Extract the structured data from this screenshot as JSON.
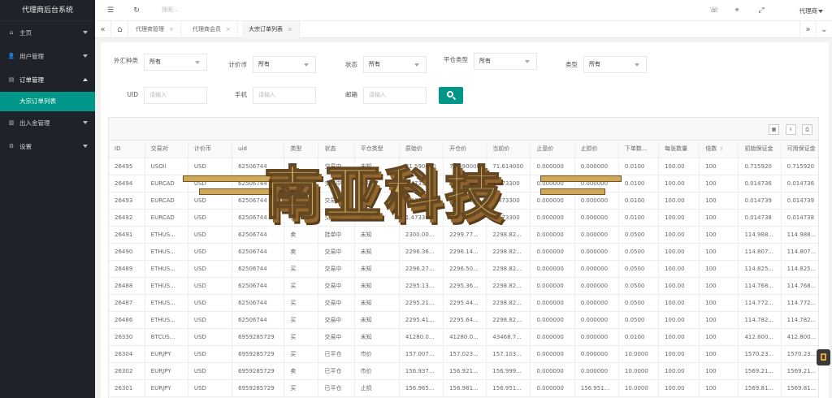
{
  "app": {
    "title": "代理商后台系统"
  },
  "sidebar": {
    "items": [
      {
        "label": "主页",
        "icon": "home-icon",
        "open": false
      },
      {
        "label": "用户管理",
        "icon": "user-icon",
        "open": false
      },
      {
        "label": "订单管理",
        "icon": "order-icon",
        "open": true
      },
      {
        "label": "出入金管理",
        "icon": "money-icon",
        "open": false
      },
      {
        "label": "设置",
        "icon": "gear-icon",
        "open": false
      }
    ],
    "sub_items": [
      {
        "label": "大宗订单列表",
        "active": true
      }
    ]
  },
  "header": {
    "search_placeholder": "搜索...",
    "user": "代理商"
  },
  "tabs": [
    {
      "label": "代理商管理",
      "active": false
    },
    {
      "label": "代理商会员",
      "active": false
    },
    {
      "label": "大宗订单列表",
      "active": true
    }
  ],
  "filters": {
    "forex_type": {
      "label": "外汇种类",
      "value": "所有"
    },
    "currency": {
      "label": "计价币",
      "value": "所有"
    },
    "status": {
      "label": "状态",
      "value": "所有"
    },
    "close_type": {
      "label": "平仓类型",
      "value": "所有"
    },
    "type": {
      "label": "类型",
      "value": "所有"
    },
    "uid": {
      "label": "UID",
      "placeholder": "请输入"
    },
    "phone": {
      "label": "手机",
      "placeholder": "请输入"
    },
    "email": {
      "label": "邮箱",
      "placeholder": "请输入"
    }
  },
  "table": {
    "columns": [
      "ID",
      "交易对",
      "计价币",
      "uid",
      "类型",
      "状态",
      "平仓类型",
      "原始价",
      "开仓价",
      "当前价",
      "止盈价",
      "止损价",
      "下单数...",
      "每张数量",
      "倍数",
      "初始保证金",
      "可用保证金"
    ],
    "rows": [
      [
        "26495",
        "USOil",
        "USD",
        "62506744",
        "买",
        "交易中",
        "未知",
        "71.590000",
        "71.590000",
        "71.614000",
        "0.000000",
        "0.000000",
        "0.0100",
        "100.00",
        "100",
        "0.715920",
        "0.715920"
      ],
      [
        "26494",
        "EURCAD",
        "USD",
        "62506744",
        "买",
        "交易中",
        "未知",
        "1.473300",
        "1.473300",
        "1.473300",
        "0.000000",
        "0.000000",
        "0.0100",
        "100.00",
        "100",
        "0.014736",
        "0.014736"
      ],
      [
        "26493",
        "EURCAD",
        "USD",
        "62506744",
        "买",
        "交易中",
        "未知",
        "1.473740",
        "1.473300",
        "1.473300",
        "0.000000",
        "0.000000",
        "0.0100",
        "100.00",
        "100",
        "0.014739",
        "0.014739"
      ],
      [
        "26492",
        "EURCAD",
        "USD",
        "62506744",
        "买",
        "交易中",
        "未知",
        "1.473300",
        "1.473310",
        "1.473300",
        "0.000000",
        "0.000000",
        "0.0100",
        "100.00",
        "100",
        "0.014738",
        "0.014738"
      ],
      [
        "26491",
        "ETHUS...",
        "USD",
        "62506744",
        "卖",
        "挂单中",
        "未知",
        "2300.00...",
        "2299.77...",
        "2298.82...",
        "0.000000",
        "0.000000",
        "0.0500",
        "100.00",
        "100",
        "114.988...",
        "114.988..."
      ],
      [
        "26490",
        "ETHUS...",
        "USD",
        "62506744",
        "卖",
        "交易中",
        "未知",
        "2296.36...",
        "2296.14...",
        "2298.82...",
        "0.000000",
        "0.000000",
        "0.0500",
        "100.00",
        "100",
        "114.807...",
        "114.807..."
      ],
      [
        "26489",
        "ETHUS...",
        "USD",
        "62506744",
        "买",
        "交易中",
        "未知",
        "2296.27...",
        "2296.50...",
        "2298.82...",
        "0.000000",
        "0.000000",
        "0.0500",
        "100.00",
        "100",
        "114.825...",
        "114.825..."
      ],
      [
        "26488",
        "ETHUS...",
        "USD",
        "62506744",
        "买",
        "交易中",
        "未知",
        "2295.13...",
        "2295.36...",
        "2298.82...",
        "0.000000",
        "0.000000",
        "0.0500",
        "100.00",
        "100",
        "114.768...",
        "114.768..."
      ],
      [
        "26487",
        "ETHUS...",
        "USD",
        "62506744",
        "买",
        "交易中",
        "未知",
        "2295.21...",
        "2295.44...",
        "2298.82...",
        "0.000000",
        "0.000000",
        "0.0500",
        "100.00",
        "100",
        "114.772...",
        "114.772..."
      ],
      [
        "26486",
        "ETHUS...",
        "USD",
        "62506744",
        "买",
        "交易中",
        "未知",
        "2295.41...",
        "2295.64...",
        "2298.82...",
        "0.000000",
        "0.000000",
        "0.0500",
        "100.00",
        "100",
        "114.782...",
        "114.782..."
      ],
      [
        "26330",
        "BTCUS...",
        "USD",
        "6959285729",
        "买",
        "交易中",
        "未知",
        "41280.0...",
        "41280.0...",
        "43468.7...",
        "0.000000",
        "0.000000",
        "0.0100",
        "100.00",
        "100",
        "412.800...",
        "412.800..."
      ],
      [
        "26304",
        "EURJPY",
        "USD",
        "6959285729",
        "买",
        "已平仓",
        "市价",
        "157.007...",
        "157.023...",
        "157.103...",
        "0.000000",
        "0.000000",
        "10.0000",
        "100.00",
        "100",
        "1570.23...",
        "1570.23..."
      ],
      [
        "26302",
        "EURJPY",
        "USD",
        "6959285729",
        "卖",
        "已平仓",
        "市价",
        "156.937...",
        "156.921...",
        "156.999...",
        "0.000000",
        "0.000000",
        "10.0000",
        "100.00",
        "100",
        "1569.21...",
        "1569.21..."
      ],
      [
        "26301",
        "EURJPY",
        "USD",
        "6959285729",
        "买",
        "已平仓",
        "止损",
        "156.965...",
        "156.981...",
        "156.951...",
        "0.000000",
        "156.951...",
        "10.0000",
        "100.00",
        "100",
        "1569.81...",
        "1569.81..."
      ]
    ]
  },
  "watermark": {
    "text": "南亚科技"
  }
}
